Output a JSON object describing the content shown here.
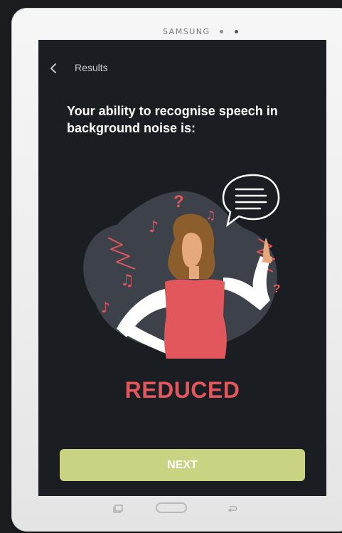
{
  "device": {
    "brand": "SAMSUNG"
  },
  "header": {
    "title": "Results",
    "back_icon": "chevron-left-icon"
  },
  "main": {
    "headline": "Your ability to recognise speech in background noise is:",
    "result": "REDUCED",
    "next_label": "NEXT"
  },
  "colors": {
    "screen_bg": "#1a1d22",
    "result_color": "#e2575b",
    "button_color": "#c9d381"
  },
  "illustration": {
    "icons": [
      "question-mark-icon",
      "music-note-icon",
      "noise-zigzag-icon",
      "speech-bubble-icon",
      "woman-figure"
    ]
  }
}
